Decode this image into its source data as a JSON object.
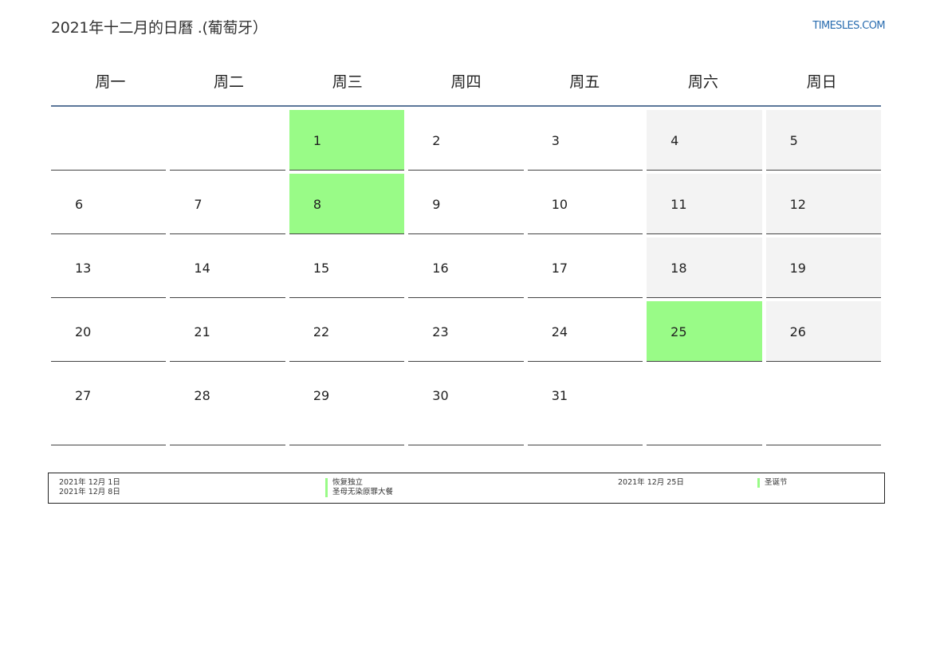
{
  "header": {
    "title": "2021年十二月的日曆 .(葡萄牙）",
    "brand": "TIMESLES.COM"
  },
  "weekdays": [
    "周一",
    "周二",
    "周三",
    "周四",
    "周五",
    "周六",
    "周日"
  ],
  "calendar": {
    "weeks": [
      [
        "",
        "",
        "1",
        "2",
        "3",
        "4",
        "5"
      ],
      [
        "6",
        "7",
        "8",
        "9",
        "10",
        "11",
        "12"
      ],
      [
        "13",
        "14",
        "15",
        "16",
        "17",
        "18",
        "19"
      ],
      [
        "20",
        "21",
        "22",
        "23",
        "24",
        "25",
        "26"
      ],
      [
        "27",
        "28",
        "29",
        "30",
        "31",
        "",
        ""
      ]
    ],
    "holiday_days": [
      "1",
      "8",
      "25"
    ]
  },
  "legend": {
    "left": [
      {
        "date": "2021年 12月 1日",
        "name": "恢复独立"
      },
      {
        "date": "2021年 12月 8日",
        "name": "圣母无染原罪大餐"
      }
    ],
    "right": [
      {
        "date": "2021年 12月 25日",
        "name": "圣诞节"
      }
    ]
  },
  "colors": {
    "holiday": "#99fb87",
    "weekend": "#f3f3f3",
    "header_rule": "#5b7799",
    "brand": "#2a6db0"
  }
}
